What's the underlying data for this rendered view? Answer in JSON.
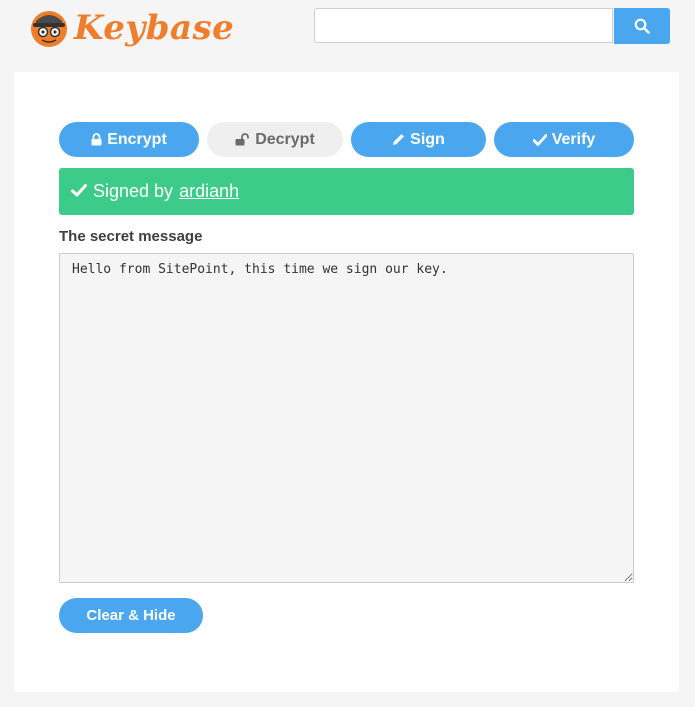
{
  "header": {
    "logo_text": "Keybase",
    "search": {
      "value": "",
      "placeholder": ""
    },
    "search_icon": "search-icon"
  },
  "tabs": [
    {
      "label": "Encrypt",
      "icon": "lock-icon"
    },
    {
      "label": "Decrypt",
      "icon": "unlock-icon"
    },
    {
      "label": "Sign",
      "icon": "pencil-icon"
    },
    {
      "label": "Verify",
      "icon": "check-icon"
    }
  ],
  "alert": {
    "prefix": "Signed by",
    "username": "ardianh",
    "icon": "check-icon"
  },
  "message": {
    "label": "The secret message",
    "value": "Hello from SitePoint, this time we sign our key."
  },
  "actions": {
    "clear_label": "Clear & Hide"
  },
  "colors": {
    "accent": "#4aa7ef",
    "success": "#3dcb8a",
    "brand": "#f07d2b",
    "background": "#f5f5f5"
  }
}
